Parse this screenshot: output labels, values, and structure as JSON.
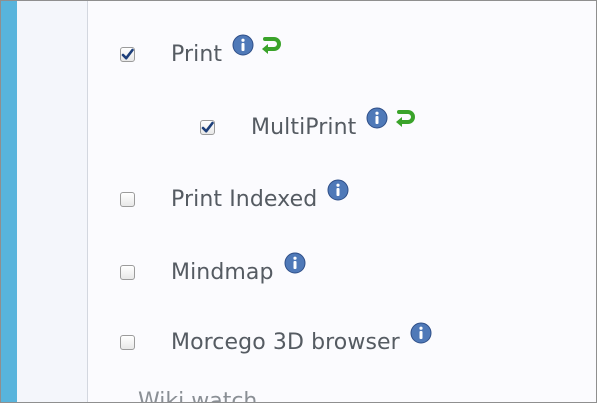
{
  "options": [
    {
      "label": "Print",
      "checked": true,
      "has_info": true,
      "has_undo": true,
      "indent": 0
    },
    {
      "label": "MultiPrint",
      "checked": true,
      "has_info": true,
      "has_undo": true,
      "indent": 1
    },
    {
      "label": "Print Indexed",
      "checked": false,
      "has_info": true,
      "has_undo": false,
      "indent": 0
    },
    {
      "label": "Mindmap",
      "checked": false,
      "has_info": true,
      "has_undo": false,
      "indent": 0
    },
    {
      "label": "Morcego 3D browser",
      "checked": false,
      "has_info": true,
      "has_undo": false,
      "indent": 0
    }
  ],
  "partial_label": "Wiki watch",
  "icons": {
    "info": "info-icon",
    "undo": "undo-arrow-icon"
  },
  "colors": {
    "accent": "#58b4dc",
    "info": "#4f79b8",
    "undo": "#3aa32a"
  }
}
